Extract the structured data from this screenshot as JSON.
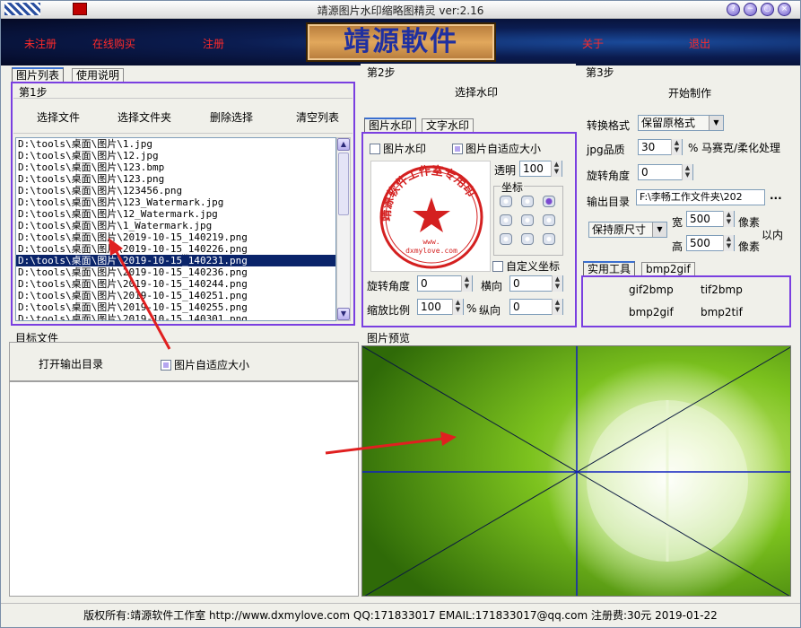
{
  "window": {
    "title": "靖源图片水印缩略图精灵 ver:2.16",
    "controls": [
      "?",
      "−",
      "○",
      "×"
    ]
  },
  "header": {
    "links": [
      "未注册",
      "在线购买",
      "注册",
      "关于",
      "退出"
    ],
    "logo_text": "靖源軟件"
  },
  "left": {
    "tabs": [
      "图片列表",
      "使用说明"
    ],
    "step1": {
      "label": "第1步",
      "buttons": [
        "选择文件",
        "选择文件夹",
        "删除选择",
        "清空列表"
      ]
    },
    "files": [
      "D:\\tools\\桌面\\图片\\1.jpg",
      "D:\\tools\\桌面\\图片\\12.jpg",
      "D:\\tools\\桌面\\图片\\123.bmp",
      "D:\\tools\\桌面\\图片\\123.png",
      "D:\\tools\\桌面\\图片\\123456.png",
      "D:\\tools\\桌面\\图片\\123_Watermark.jpg",
      "D:\\tools\\桌面\\图片\\12_Watermark.jpg",
      "D:\\tools\\桌面\\图片\\1_Watermark.jpg",
      "D:\\tools\\桌面\\图片\\2019-10-15_140219.png",
      "D:\\tools\\桌面\\图片\\2019-10-15_140226.png",
      "D:\\tools\\桌面\\图片\\2019-10-15_140231.png",
      "D:\\tools\\桌面\\图片\\2019-10-15_140236.png",
      "D:\\tools\\桌面\\图片\\2019-10-15_140244.png",
      "D:\\tools\\桌面\\图片\\2019-10-15_140251.png",
      "D:\\tools\\桌面\\图片\\2019-10-15_140255.png",
      "D:\\tools\\桌面\\图片\\2019-10-15_140301.png"
    ],
    "selected_index": 10,
    "target": {
      "label": "目标文件",
      "open_button": "打开输出目录",
      "autofit_label": "图片自适应大小"
    }
  },
  "step2": {
    "label": "第2步",
    "select_button": "选择水印",
    "tabs": [
      "图片水印",
      "文字水印"
    ],
    "image_wm_label": "图片水印",
    "autofit_label": "图片自适应大小",
    "opacity_label": "透明",
    "opacity_value": "100",
    "coords_label": "坐标",
    "grid_selected": 2,
    "custom_coords_label": "自定义坐标",
    "rotate_label": "旋转角度",
    "rotate_value": "0",
    "horiz_label": "横向",
    "horiz_value": "0",
    "scale_label": "缩放比例",
    "scale_value": "100",
    "percent": "%",
    "vert_label": "纵向",
    "vert_value": "0",
    "stamp_text": "靖源软件工作室专用印",
    "stamp_url": "www.\ndxmylove.com"
  },
  "step3": {
    "label": "第3步",
    "start_button": "开始制作",
    "format_label": "转换格式",
    "format_value": "保留原格式",
    "quality_label": "jpg品质",
    "quality_value": "30",
    "percent": "%",
    "mosaic_label": "马赛克/柔化处理",
    "rotate_label": "旋转角度",
    "rotate_value": "0",
    "outdir_label": "输出目录",
    "outdir_value": "F:\\李畅工作文件夹\\202",
    "browse": "...",
    "size_mode": "保持原尺寸",
    "width_label": "宽",
    "width_value": "500",
    "height_label": "高",
    "height_value": "500",
    "unit": "像素",
    "within": "以内",
    "tools_tabs": [
      "实用工具",
      "bmp2gif"
    ],
    "tools": [
      "gif2bmp",
      "tif2bmp",
      "bmp2gif",
      "bmp2tif"
    ]
  },
  "preview": {
    "label": "图片预览"
  },
  "footer": {
    "text": "版权所有:靖源软件工作室 http://www.dxmylove.com QQ:171833017 EMAIL:171833017@qq.com 注册费:30元 2019-01-22"
  },
  "colors": {
    "frame": "#7a3fe0",
    "link_red": "#ff2a2a",
    "selection": "#0a246a",
    "stamp_red": "#d42020"
  }
}
